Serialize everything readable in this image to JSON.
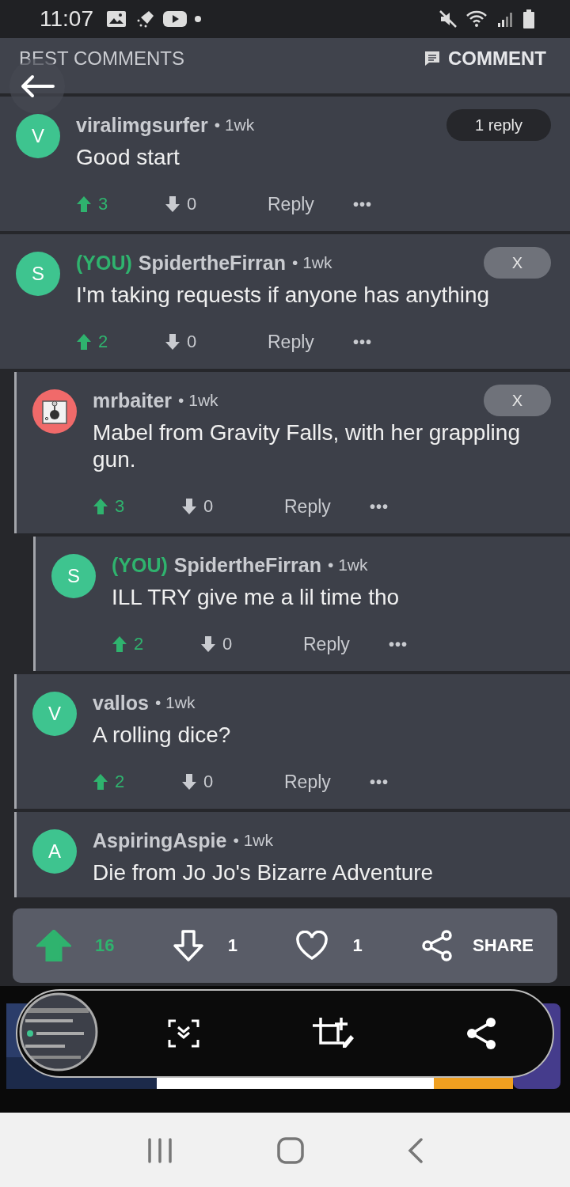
{
  "status_bar": {
    "time": "11:07"
  },
  "header": {
    "title": "BEST COMMENTS",
    "action": "COMMENT"
  },
  "comments": [
    {
      "author": "viralimgsurfer",
      "avatar": {
        "letter": "V",
        "color": "#3ec48f"
      },
      "time": "• 1wk",
      "text": "Good start",
      "upvotes": "3",
      "downvotes": "0",
      "reply": "Reply",
      "more": "•••",
      "badge": {
        "kind": "replies",
        "label": "1 reply"
      }
    },
    {
      "author": "SpidertheFirran",
      "avatar": {
        "letter": "S",
        "color": "#3ec48f"
      },
      "you_label": "(YOU)",
      "time": "• 1wk",
      "text": "I'm taking requests if anyone has anything",
      "upvotes": "2",
      "downvotes": "0",
      "reply": "Reply",
      "more": "•••",
      "badge": {
        "kind": "close",
        "label": "X"
      },
      "children": [
        {
          "author": "mrbaiter",
          "avatar": {
            "kind": "joystick",
            "color": "#f06a6a"
          },
          "time": "• 1wk",
          "text": "Mabel from Gravity Falls, with her grappling gun.",
          "upvotes": "3",
          "downvotes": "0",
          "reply": "Reply",
          "more": "•••",
          "badge": {
            "kind": "close",
            "label": "X"
          },
          "children": [
            {
              "author": "SpidertheFirran",
              "avatar": {
                "letter": "S",
                "color": "#3ec48f"
              },
              "you_label": "(YOU)",
              "time": "• 1wk",
              "text": "ILL TRY give me a lil time tho",
              "upvotes": "2",
              "downvotes": "0",
              "reply": "Reply",
              "more": "•••"
            }
          ]
        },
        {
          "author": "vallos",
          "avatar": {
            "letter": "V",
            "color": "#3ec48f"
          },
          "time": "• 1wk",
          "text": "A rolling dice?",
          "upvotes": "2",
          "downvotes": "0",
          "reply": "Reply",
          "more": "•••"
        },
        {
          "author": "AspiringAspie",
          "avatar": {
            "letter": "A",
            "color": "#3ec48f"
          },
          "time": "• 1wk",
          "text": "Die from Jo Jo's Bizarre Adventure"
        }
      ]
    }
  ],
  "post_bar": {
    "upvotes": "16",
    "upvoted": true,
    "downvotes": "1",
    "likes": "1",
    "share": "SHARE"
  }
}
